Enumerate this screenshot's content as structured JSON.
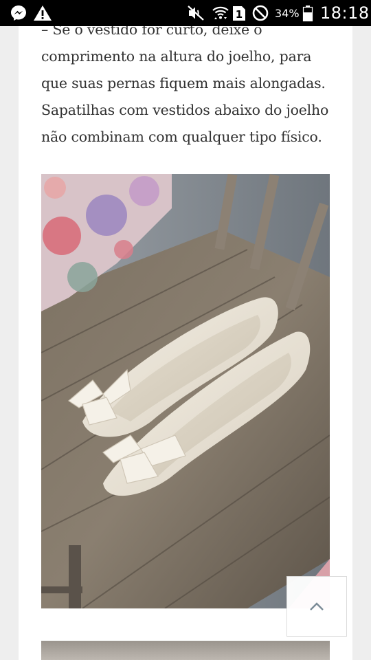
{
  "status_bar": {
    "battery_percent": "34%",
    "time": "18:18",
    "sim_slot": "1",
    "icons": [
      "messenger-icon",
      "warning-icon",
      "mute-icon",
      "wifi-icon",
      "sim-icon",
      "do-not-disturb-icon",
      "battery-icon"
    ]
  },
  "article": {
    "lines": [
      "– Se o vestido for curto, deixe o",
      "comprimento na altura do joelho, para",
      "que suas pernas fiquem mais alongadas.",
      "Sapatilhas com vestidos abaixo do joelho",
      "não combinam com qualquer tipo físico."
    ]
  },
  "photo": {
    "subject": "bow-flat-shoes"
  },
  "back_to_top": {
    "icon": "chevron-up-icon"
  },
  "colors": {
    "text": "#333333",
    "status_bar": "#000000",
    "page_background": "#eeeeee",
    "card_background": "#ffffff"
  }
}
